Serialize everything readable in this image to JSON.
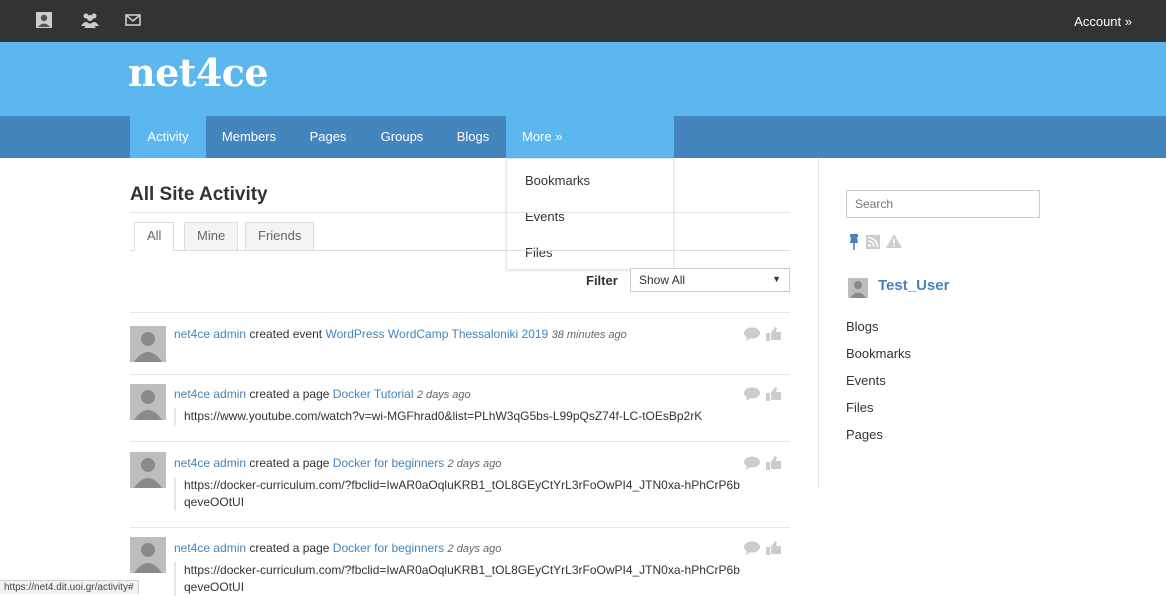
{
  "topbar": {
    "account": "Account »",
    "icons": [
      "user-icon",
      "users-icon",
      "mail-icon"
    ]
  },
  "header": {
    "logo": "net4ce"
  },
  "nav": {
    "items": [
      "Activity",
      "Members",
      "Pages",
      "Groups",
      "Blogs",
      "More »"
    ],
    "dropdown": [
      "Bookmarks",
      "Events",
      "Files"
    ]
  },
  "main": {
    "title": "All Site Activity",
    "tabs": [
      "All",
      "Mine",
      "Friends"
    ],
    "filter_label": "Filter",
    "filter_value": "Show All",
    "activities": [
      {
        "author": "net4ce admin",
        "action": "created event",
        "target": "WordPress WordCamp Thessaloniki 2019",
        "ago": "38 minutes ago",
        "body": ""
      },
      {
        "author": "net4ce admin",
        "action": "created a page",
        "target": "Docker Tutorial",
        "ago": "2 days ago",
        "body": "https://www.youtube.com/watch?v=wi-MGFhrad0&list=PLhW3qG5bs-L99pQsZ74f-LC-tOEsBp2rK"
      },
      {
        "author": "net4ce admin",
        "action": "created a page",
        "target": "Docker for beginners",
        "ago": "2 days ago",
        "body": "https://docker-curriculum.com/?fbclid=IwAR0aOqluKRB1_tOL8GEyCtYrL3rFoOwPI4_JTN0xa-hPhCrP6bqeveOOtUI"
      },
      {
        "author": "net4ce admin",
        "action": "created a page",
        "target": "Docker for beginners",
        "ago": "2 days ago",
        "body": "https://docker-curriculum.com/?fbclid=IwAR0aOqluKRB1_tOL8GEyCtYrL3rFoOwPI4_JTN0xa-hPhCrP6bqeveOOtUI"
      }
    ]
  },
  "sidebar": {
    "search_placeholder": "Search",
    "user": "Test_User",
    "links": [
      "Blogs",
      "Bookmarks",
      "Events",
      "Files",
      "Pages"
    ]
  },
  "status_url": "https://net4.dit.uoi.gr/activity#",
  "colors": {
    "topbar": "#333333",
    "header": "#5bb7ee",
    "nav": "#4485bd",
    "link": "#4485bd"
  }
}
